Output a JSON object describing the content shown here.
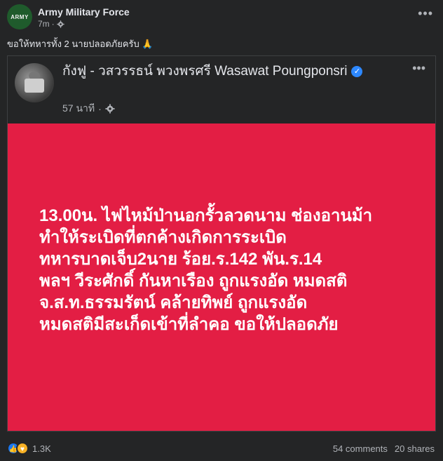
{
  "post": {
    "page_name": "Army Military Force",
    "time": "7m",
    "time_separator": "·",
    "caption": "ขอให้ทหารทั้ง 2 นายปลอดภัยครับ 🙏",
    "avatar_text": "ARMY",
    "more_icon": "more-horizontal-icon"
  },
  "shared": {
    "author_name": "กังฟู - วสวรรธน์ พวงพรศรี   Wasawat Poungponsri",
    "time": "57 นาที",
    "time_separator": "·",
    "verified_icon": "verified-badge-icon",
    "privacy_icon": "gear-icon",
    "more_icon": "more-horizontal-icon",
    "text": "13.00น.  ไฟไหม้ป่านอกรั้วลวดนาม ช่องอานม้า ทำให้ระเบิดที่ตกค้างเกิดการระเบิด\nทหารบาดเจ็บ2นาย ร้อย.ร.142 พัน.ร.14\nพลฯ วีระศักดิ์ กันหาเรือง  ถูกแรงอัด หมดสติ จ.ส.ท.ธรรมรัตน์ คล้ายทิพย์ ถูกแรงอัด\nหมดสติมีสะเก็ดเข้าที่ลำคอ ขอให้ปลอดภัย",
    "background_color": "#e31e44"
  },
  "footer": {
    "reaction_count": "1.3K",
    "comments": "54 comments",
    "shares": "20 shares",
    "reaction_icons": [
      "like-icon",
      "care-icon"
    ]
  }
}
